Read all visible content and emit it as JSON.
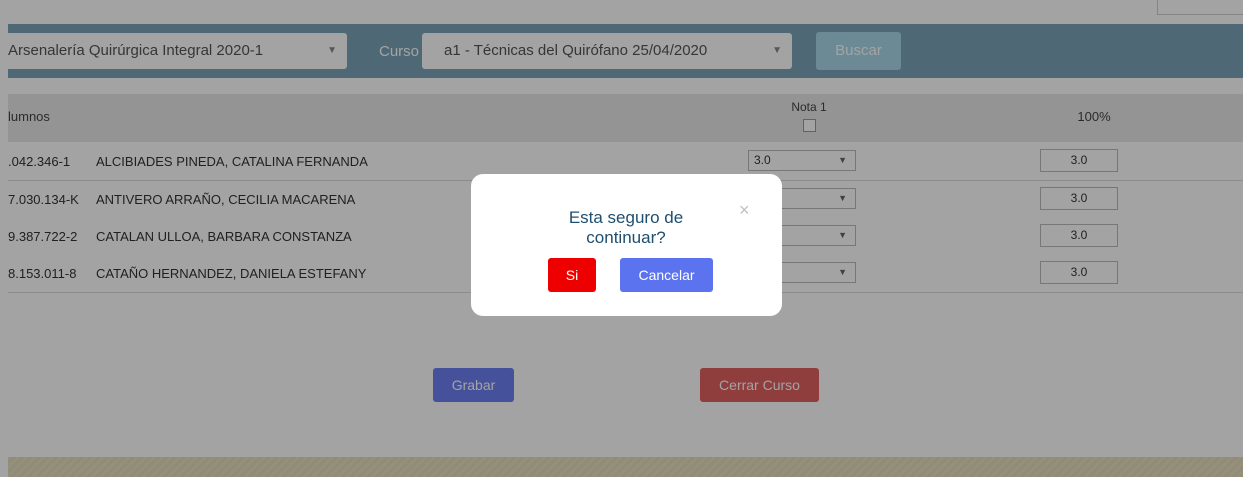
{
  "filters": {
    "carrera_select": "Arsenalería Quirúrgica Integral  2020-1",
    "curso_label": "Curso",
    "curso_select": "a1 - Técnicas del Quirófano  25/04/2020",
    "buscar_label": "Buscar"
  },
  "table": {
    "col_alumnos": "lumnos",
    "col_nota": "Nota 1",
    "col_pct": "100%",
    "rows": [
      {
        "rut": ".042.346-1",
        "name": "ALCIBIADES PINEDA, CATALINA FERNANDA",
        "grade": "3.0",
        "pct": "3.0"
      },
      {
        "rut": "7.030.134-K",
        "name": "ANTIVERO ARRAÑO, CECILIA MACARENA",
        "grade": "",
        "pct": "3.0"
      },
      {
        "rut": "9.387.722-2",
        "name": "CATALAN ULLOA, BARBARA CONSTANZA",
        "grade": "",
        "pct": "3.0"
      },
      {
        "rut": "8.153.011-8",
        "name": "CATAÑO HERNANDEZ, DANIELA ESTEFANY",
        "grade": "",
        "pct": "3.0"
      }
    ]
  },
  "actions": {
    "grabar_label": "Grabar",
    "cerrar_label": "Cerrar Curso"
  },
  "modal": {
    "title": "Esta seguro de continuar?",
    "close_symbol": "×",
    "si_label": "Si",
    "cancel_label": "Cancelar"
  },
  "icons": {
    "dropdown_arrow": "▼"
  },
  "colors": {
    "filter_bar": "#7aa5b8",
    "buscar": "#a8d8ea",
    "grabar": "#6e7ff2",
    "cerrar": "#e26060",
    "si": "#ee0000",
    "cancel": "#5c73ef"
  }
}
